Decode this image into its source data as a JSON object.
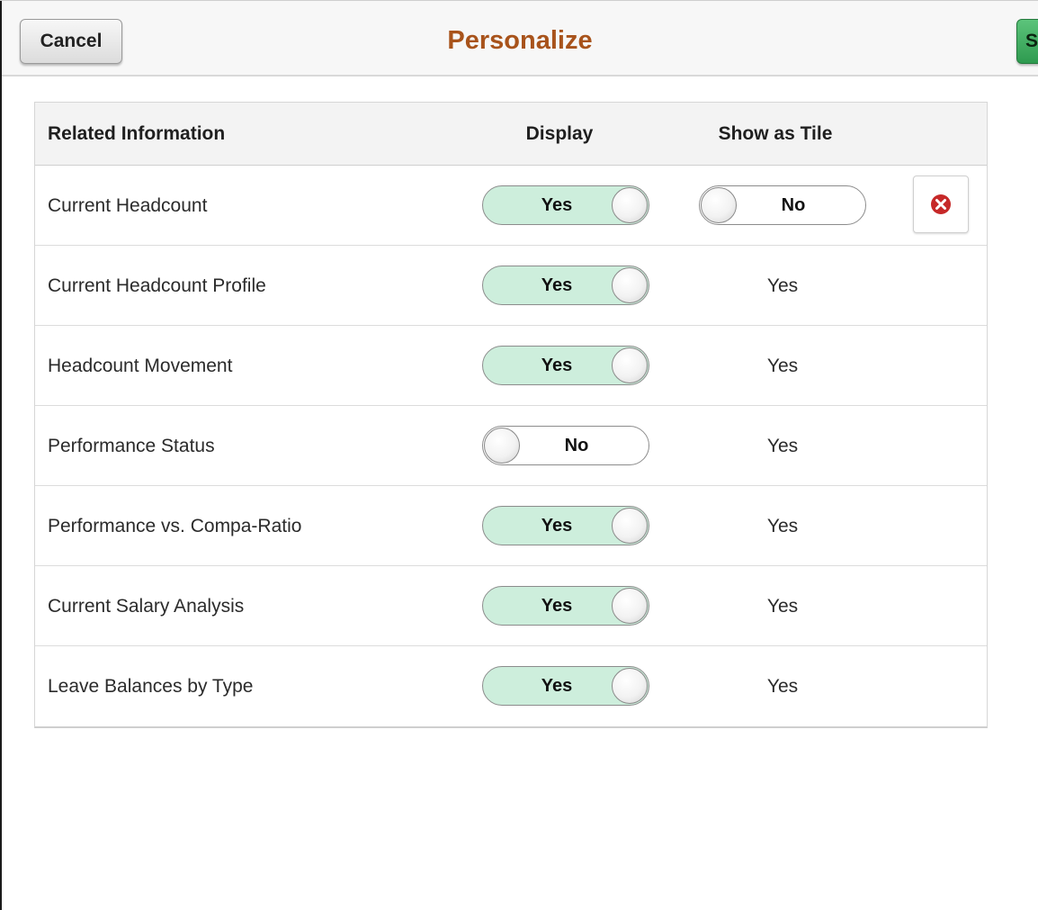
{
  "header": {
    "title": "Personalize",
    "cancel_label": "Cancel",
    "save_label": "Save"
  },
  "grid": {
    "columns": {
      "info": "Related Information",
      "display": "Display",
      "tile": "Show as Tile"
    },
    "rows": [
      {
        "label": "Current Headcount",
        "display": "Yes",
        "display_on": true,
        "tile": "No",
        "tile_toggle": true,
        "tile_on": false,
        "deletable": true
      },
      {
        "label": "Current Headcount Profile",
        "display": "Yes",
        "display_on": true,
        "tile": "Yes"
      },
      {
        "label": "Headcount Movement",
        "display": "Yes",
        "display_on": true,
        "tile": "Yes"
      },
      {
        "label": "Performance Status",
        "display": "No",
        "display_on": false,
        "tile": "Yes"
      },
      {
        "label": "Performance vs. Compa-Ratio",
        "display": "Yes",
        "display_on": true,
        "tile": "Yes"
      },
      {
        "label": "Current Salary Analysis",
        "display": "Yes",
        "display_on": true,
        "tile": "Yes"
      },
      {
        "label": "Leave Balances by Type",
        "display": "Yes",
        "display_on": true,
        "tile": "Yes"
      }
    ]
  },
  "colors": {
    "title": "#a8531b",
    "toggle_on": "#cdeedc",
    "save_button": "#3fae61",
    "delete_icon": "#c62828"
  },
  "icons": {
    "delete": "close-circle-icon"
  }
}
